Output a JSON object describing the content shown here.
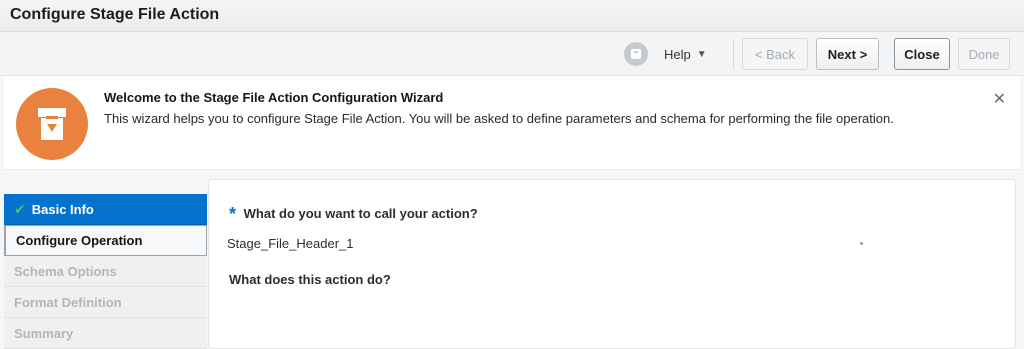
{
  "window": {
    "title": "Configure Stage File Action"
  },
  "toolbar": {
    "help_label": "Help",
    "back_label": "< Back",
    "next_label": "Next >",
    "close_label": "Close",
    "done_label": "Done"
  },
  "welcome": {
    "heading": "Welcome to the Stage File Action Configuration Wizard",
    "description": "This wizard helps you to configure Stage File Action. You will be asked to define parameters and schema for performing the file operation.",
    "badge_color": "#e9813f"
  },
  "steps": [
    {
      "label": "Basic Info",
      "state": "complete"
    },
    {
      "label": "Configure Operation",
      "state": "current"
    },
    {
      "label": "Schema Options",
      "state": "disabled"
    },
    {
      "label": "Format Definition",
      "state": "disabled"
    },
    {
      "label": "Summary",
      "state": "disabled"
    }
  ],
  "form": {
    "q1_label": "What do you want to call your action?",
    "q1_required_mark": "*",
    "q1_value": "Stage_File_Header_1",
    "q2_label": "What does this action do?"
  },
  "colors": {
    "accent": "#0572ce",
    "check": "#4fc840"
  }
}
